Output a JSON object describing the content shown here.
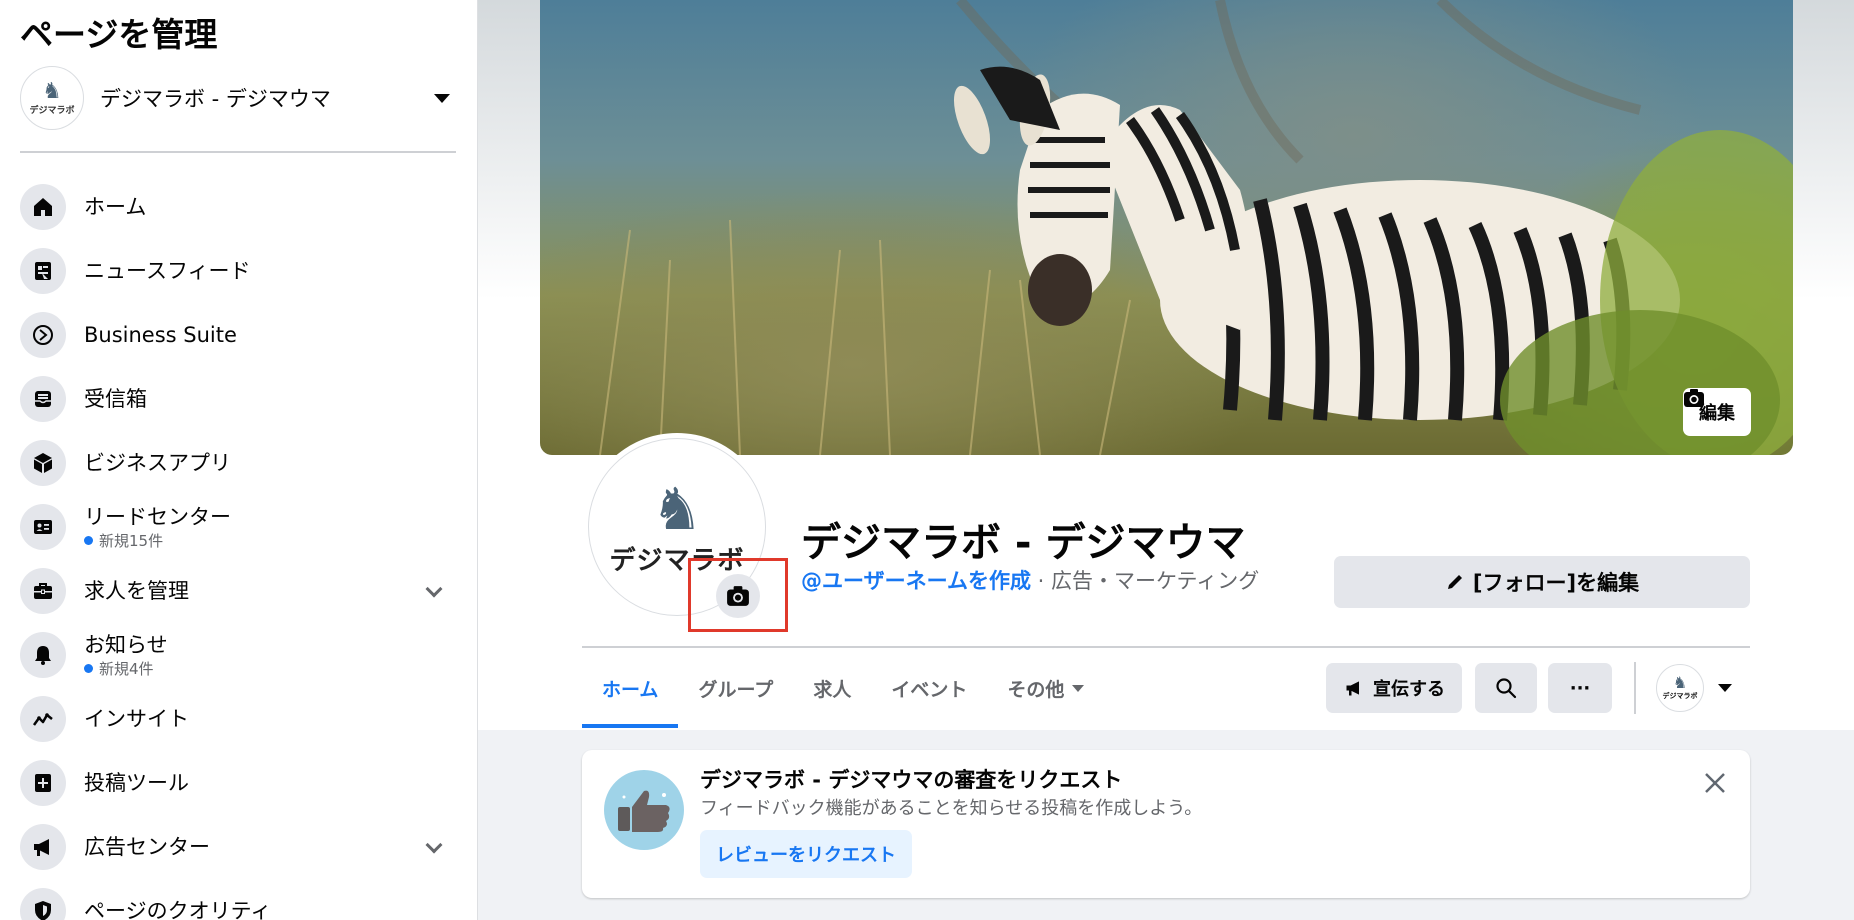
{
  "sidebar": {
    "title": "ページを管理",
    "page_name": "デジマラボ - デジマウマ",
    "avatar_logo": "デジマラボ",
    "items": [
      {
        "label": "ホーム",
        "icon": "home-icon"
      },
      {
        "label": "ニュースフィード",
        "icon": "news-feed-icon"
      },
      {
        "label": "Business Suite",
        "icon": "business-suite-icon"
      },
      {
        "label": "受信箱",
        "icon": "inbox-icon"
      },
      {
        "label": "ビジネスアプリ",
        "icon": "business-apps-icon"
      },
      {
        "label": "リードセンター",
        "sub": "新規15件",
        "icon": "lead-center-icon"
      },
      {
        "label": "求人を管理",
        "icon": "jobs-icon",
        "expandable": true
      },
      {
        "label": "お知らせ",
        "sub": "新規4件",
        "icon": "notifications-icon"
      },
      {
        "label": "インサイト",
        "icon": "insights-icon"
      },
      {
        "label": "投稿ツール",
        "icon": "publishing-tools-icon"
      },
      {
        "label": "広告センター",
        "icon": "ad-center-icon",
        "expandable": true
      },
      {
        "label": "ページのクオリティ",
        "icon": "page-quality-icon"
      }
    ]
  },
  "cover": {
    "edit_label": "編集"
  },
  "profile": {
    "logo_text": "デジマラボ",
    "page_name": "デジマラボ - デジマウマ",
    "username_link": "@ユーザーネームを作成",
    "category": " · 広告・マーケティング",
    "follow_edit_label": "[フォロー]を編集"
  },
  "tabs": [
    {
      "label": "ホーム",
      "active": true
    },
    {
      "label": "グループ"
    },
    {
      "label": "求人"
    },
    {
      "label": "イベント"
    },
    {
      "label": "その他",
      "dropdown": true
    }
  ],
  "actions": {
    "promote_label": "宣伝する",
    "more_label": "···",
    "account_logo": "デジマラボ"
  },
  "review_card": {
    "title": "デジマラボ - デジマウマの審査をリクエスト",
    "description": "フィードバック機能があることを知らせる投稿を作成しよう。",
    "button_label": "レビューをリクエスト"
  },
  "colors": {
    "accent": "#1877f2",
    "highlight": "#e0392b"
  }
}
